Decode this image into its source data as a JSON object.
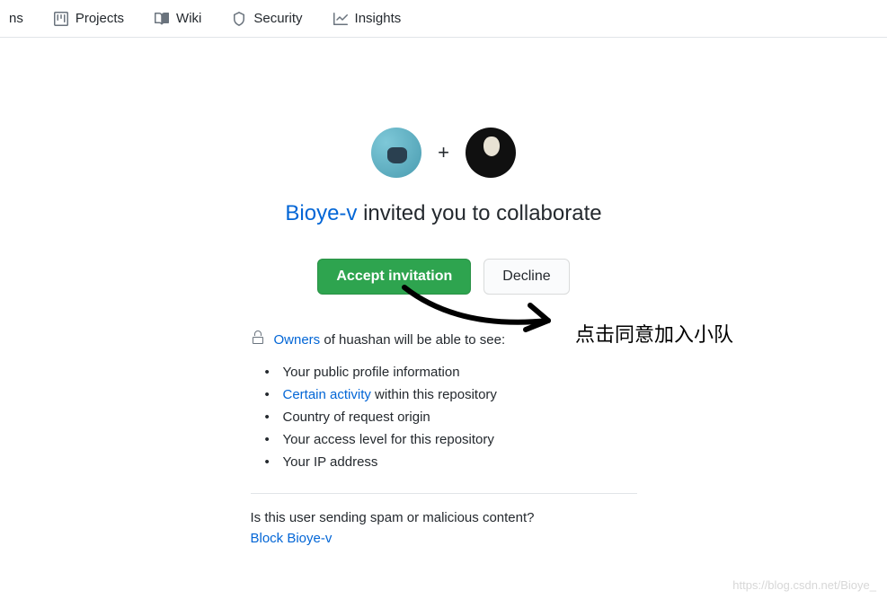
{
  "nav": {
    "cut": "ns",
    "tabs": [
      {
        "label": "Projects",
        "icon": "projects-icon"
      },
      {
        "label": "Wiki",
        "icon": "wiki-icon"
      },
      {
        "label": "Security",
        "icon": "security-icon"
      },
      {
        "label": "Insights",
        "icon": "insights-icon"
      }
    ]
  },
  "invite": {
    "inviter": "Bioye-v",
    "title_suffix": " invited you to collaborate",
    "plus": "+",
    "accept_label": "Accept invitation",
    "decline_label": "Decline"
  },
  "info": {
    "owners_link": "Owners",
    "owners_rest": " of huashan will be able to see:",
    "items": {
      "0": "Your public profile information",
      "1_link": "Certain activity",
      "1_rest": " within this repository",
      "2": "Country of request origin",
      "3": "Your access level for this repository",
      "4": "Your IP address"
    }
  },
  "spam": {
    "question": "Is this user sending spam or malicious content?",
    "block_link": "Block Bioye-v"
  },
  "annotation": "点击同意加入小队",
  "watermark": "https://blog.csdn.net/Bioye_"
}
